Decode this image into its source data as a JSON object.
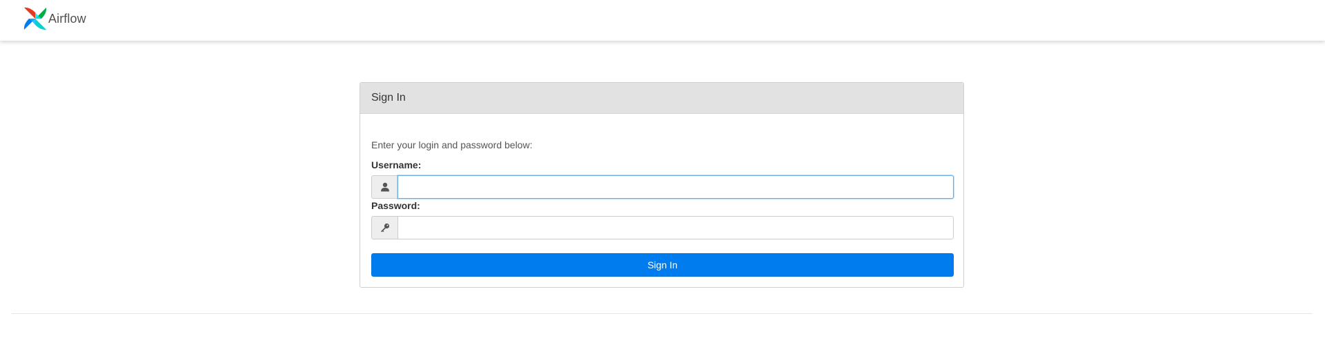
{
  "navbar": {
    "brand_name": "Airflow",
    "logo_icon": "airflow-pinwheel-icon"
  },
  "login": {
    "heading": "Sign In",
    "intro": "Enter your login and password below:",
    "username_label": "Username:",
    "username_value": "",
    "username_icon": "user-icon",
    "password_label": "Password:",
    "password_value": "",
    "password_icon": "key-icon",
    "submit_label": "Sign In"
  },
  "colors": {
    "primary": "#017cee",
    "heading_bg": "#e2e2e2",
    "focus_border": "#66afe9"
  }
}
